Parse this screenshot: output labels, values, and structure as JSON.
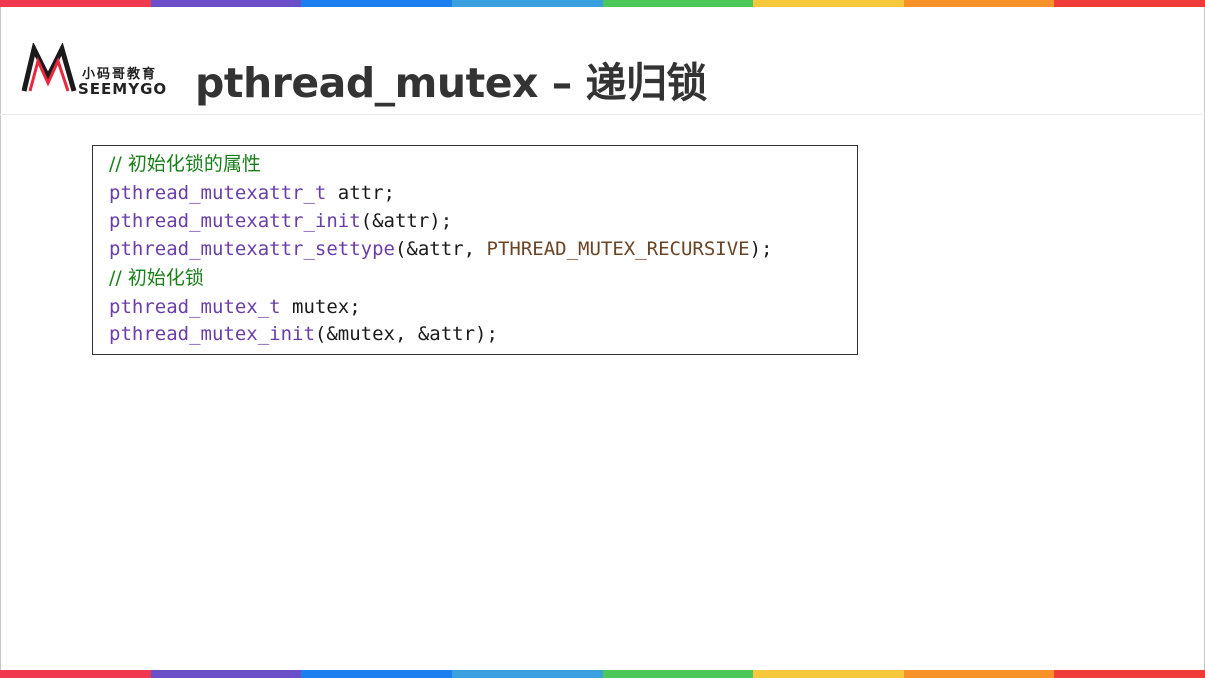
{
  "colors": {
    "stripe": [
      "#f0384e",
      "#6a4fc8",
      "#1b7ff0",
      "#3aa0e0",
      "#4cc85a",
      "#f5c93b",
      "#f7922a",
      "#f03b3b"
    ],
    "comment": "#1a7f1a",
    "type_name": "#6a3ea8",
    "constant": "#6b4426",
    "title": "#333333"
  },
  "logo": {
    "icon": "seemygo-m-logo-icon",
    "cn_text": "小码哥教育",
    "en_text": "SEEMYGO"
  },
  "header": {
    "title": "pthread_mutex – 递归锁"
  },
  "code": {
    "lines": [
      {
        "tokens": [
          {
            "cls": "c-comment",
            "text": "// 初始化锁的属性"
          }
        ]
      },
      {
        "tokens": [
          {
            "cls": "c-type",
            "text": "pthread_mutexattr_t"
          },
          {
            "cls": "c-plain",
            "text": " attr;"
          }
        ]
      },
      {
        "tokens": [
          {
            "cls": "c-type",
            "text": "pthread_mutexattr_init"
          },
          {
            "cls": "c-plain",
            "text": "(&attr);"
          }
        ]
      },
      {
        "tokens": [
          {
            "cls": "c-type",
            "text": "pthread_mutexattr_settype"
          },
          {
            "cls": "c-plain",
            "text": "(&attr, "
          },
          {
            "cls": "c-const",
            "text": "PTHREAD_MUTEX_RECURSIVE"
          },
          {
            "cls": "c-plain",
            "text": ");"
          }
        ]
      },
      {
        "tokens": [
          {
            "cls": "c-comment",
            "text": "// 初始化锁"
          }
        ]
      },
      {
        "tokens": [
          {
            "cls": "c-type",
            "text": "pthread_mutex_t"
          },
          {
            "cls": "c-plain",
            "text": " mutex;"
          }
        ]
      },
      {
        "tokens": [
          {
            "cls": "c-type",
            "text": "pthread_mutex_init"
          },
          {
            "cls": "c-plain",
            "text": "(&mutex, &attr);"
          }
        ]
      }
    ]
  }
}
